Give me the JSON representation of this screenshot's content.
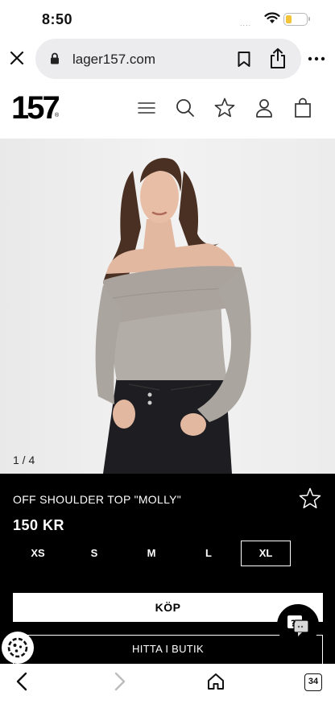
{
  "status_bar": {
    "time": "8:50",
    "signal": "....",
    "battery_level": 0.3
  },
  "browser": {
    "url": "lager157.com",
    "tab_count": "34"
  },
  "site": {
    "logo": "157",
    "logo_mark": "®"
  },
  "product": {
    "image_counter": "1 / 4",
    "name": "OFF SHOULDER TOP \"MOLLY\"",
    "price": "150 KR",
    "sizes": [
      "XS",
      "S",
      "M",
      "L",
      "XL"
    ],
    "selected_size": "XL",
    "buy_label": "KÖP",
    "store_label": "HITTA I BUTIK",
    "chat_label": "?"
  },
  "colors": {
    "panel": "#000000",
    "image_bg": "#eeeeee",
    "top_garment": "#b0aaa4",
    "battery": "#f3c33a"
  }
}
